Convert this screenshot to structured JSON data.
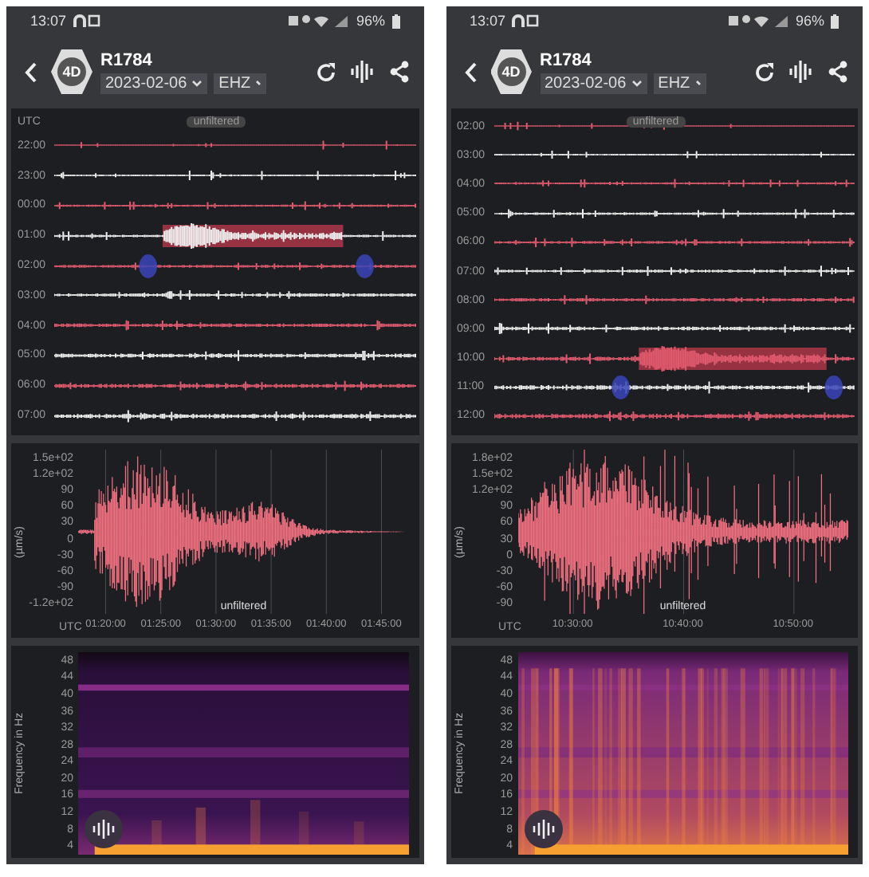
{
  "phones": [
    {
      "status": {
        "time": "13:07",
        "battery": "96%"
      },
      "toolbar": {
        "logo": "4D",
        "station": "R1784",
        "date": "2023-02-06",
        "channel": "EHZ"
      },
      "helicorder": {
        "axis": "UTC",
        "filter": "unfiltered",
        "rows": [
          {
            "time": "22:00",
            "color": "#e05a6e",
            "event": false,
            "markers": false
          },
          {
            "time": "23:00",
            "color": "#eeeeee",
            "event": false,
            "markers": false
          },
          {
            "time": "00:00",
            "color": "#e05a6e",
            "event": false,
            "markers": false
          },
          {
            "time": "01:00",
            "color": "#eeeeee",
            "event": true,
            "markers": false
          },
          {
            "time": "02:00",
            "color": "#e05a6e",
            "event": false,
            "markers": true
          },
          {
            "time": "03:00",
            "color": "#eeeeee",
            "event": false,
            "markers": false
          },
          {
            "time": "04:00",
            "color": "#e05a6e",
            "event": false,
            "markers": false
          },
          {
            "time": "05:00",
            "color": "#eeeeee",
            "event": false,
            "markers": false
          },
          {
            "time": "06:00",
            "color": "#e05a6e",
            "event": false,
            "markers": false
          },
          {
            "time": "07:00",
            "color": "#eeeeee",
            "event": false,
            "markers": false
          }
        ]
      },
      "waveform": {
        "ylabel": "(µm/s)",
        "yticks": [
          "1.5e+02",
          "1.2e+02",
          "90",
          "60",
          "30",
          "0",
          "-30",
          "-60",
          "-90",
          "-1.2e+02"
        ],
        "filter": "unfiltered",
        "xaxis": "UTC",
        "xticks": [
          "01:20:00",
          "01:25:00",
          "01:30:00",
          "01:35:00",
          "01:40:00",
          "01:45:00"
        ]
      },
      "spectrogram": {
        "ylabel": "Frequency in Hz",
        "yticks": [
          "48",
          "44",
          "40",
          "36",
          "32",
          "28",
          "24",
          "20",
          "16",
          "12",
          "8",
          "4"
        ]
      }
    },
    {
      "status": {
        "time": "13:07",
        "battery": "96%"
      },
      "toolbar": {
        "logo": "4D",
        "station": "R1784",
        "date": "2023-02-06",
        "channel": "EHZ"
      },
      "helicorder": {
        "filter": "unfiltered",
        "rows": [
          {
            "time": "02:00",
            "color": "#e05a6e",
            "event": false,
            "markers": false
          },
          {
            "time": "03:00",
            "color": "#eeeeee",
            "event": false,
            "markers": false
          },
          {
            "time": "04:00",
            "color": "#e05a6e",
            "event": false,
            "markers": false
          },
          {
            "time": "05:00",
            "color": "#eeeeee",
            "event": false,
            "markers": false
          },
          {
            "time": "06:00",
            "color": "#e05a6e",
            "event": false,
            "markers": false
          },
          {
            "time": "07:00",
            "color": "#eeeeee",
            "event": false,
            "markers": false
          },
          {
            "time": "08:00",
            "color": "#e05a6e",
            "event": false,
            "markers": false
          },
          {
            "time": "09:00",
            "color": "#eeeeee",
            "event": false,
            "markers": false
          },
          {
            "time": "10:00",
            "color": "#e05a6e",
            "event": true,
            "markers": false
          },
          {
            "time": "11:00",
            "color": "#eeeeee",
            "event": false,
            "markers": true
          },
          {
            "time": "12:00",
            "color": "#e05a6e",
            "event": false,
            "markers": false
          }
        ]
      },
      "waveform": {
        "ylabel": "(µm/s)",
        "yticks": [
          "1.8e+02",
          "1.5e+02",
          "1.2e+02",
          "90",
          "60",
          "30",
          "0",
          "-30",
          "-60",
          "-90"
        ],
        "filter": "unfiltered",
        "xaxis": "UTC",
        "xticks": [
          "10:30:00",
          "10:40:00",
          "10:50:00"
        ]
      },
      "spectrogram": {
        "ylabel": "Frequency in Hz",
        "yticks": [
          "48",
          "44",
          "40",
          "36",
          "32",
          "28",
          "24",
          "20",
          "16",
          "12",
          "8",
          "4"
        ]
      }
    }
  ]
}
